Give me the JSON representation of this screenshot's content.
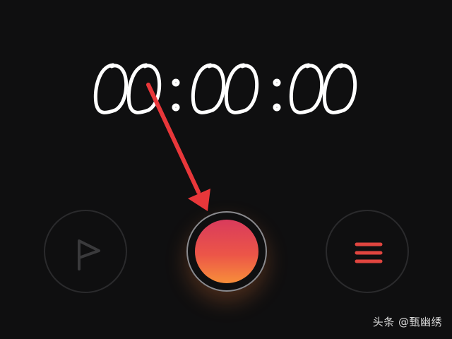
{
  "timer": {
    "display": "00:00:00"
  },
  "controls": {
    "flag_icon": "flag-icon",
    "record_icon": "record-icon",
    "menu_icon": "menu-icon"
  },
  "annotation": {
    "arrow_color": "#e8373a"
  },
  "colors": {
    "background": "#0f0f10",
    "record_top": "#d93b5c",
    "record_bottom": "#f78e3a",
    "menu_icon": "#e0453f",
    "flag_icon": "#3a3a3c"
  },
  "watermark": {
    "text": "头条 @甄幽绣"
  }
}
